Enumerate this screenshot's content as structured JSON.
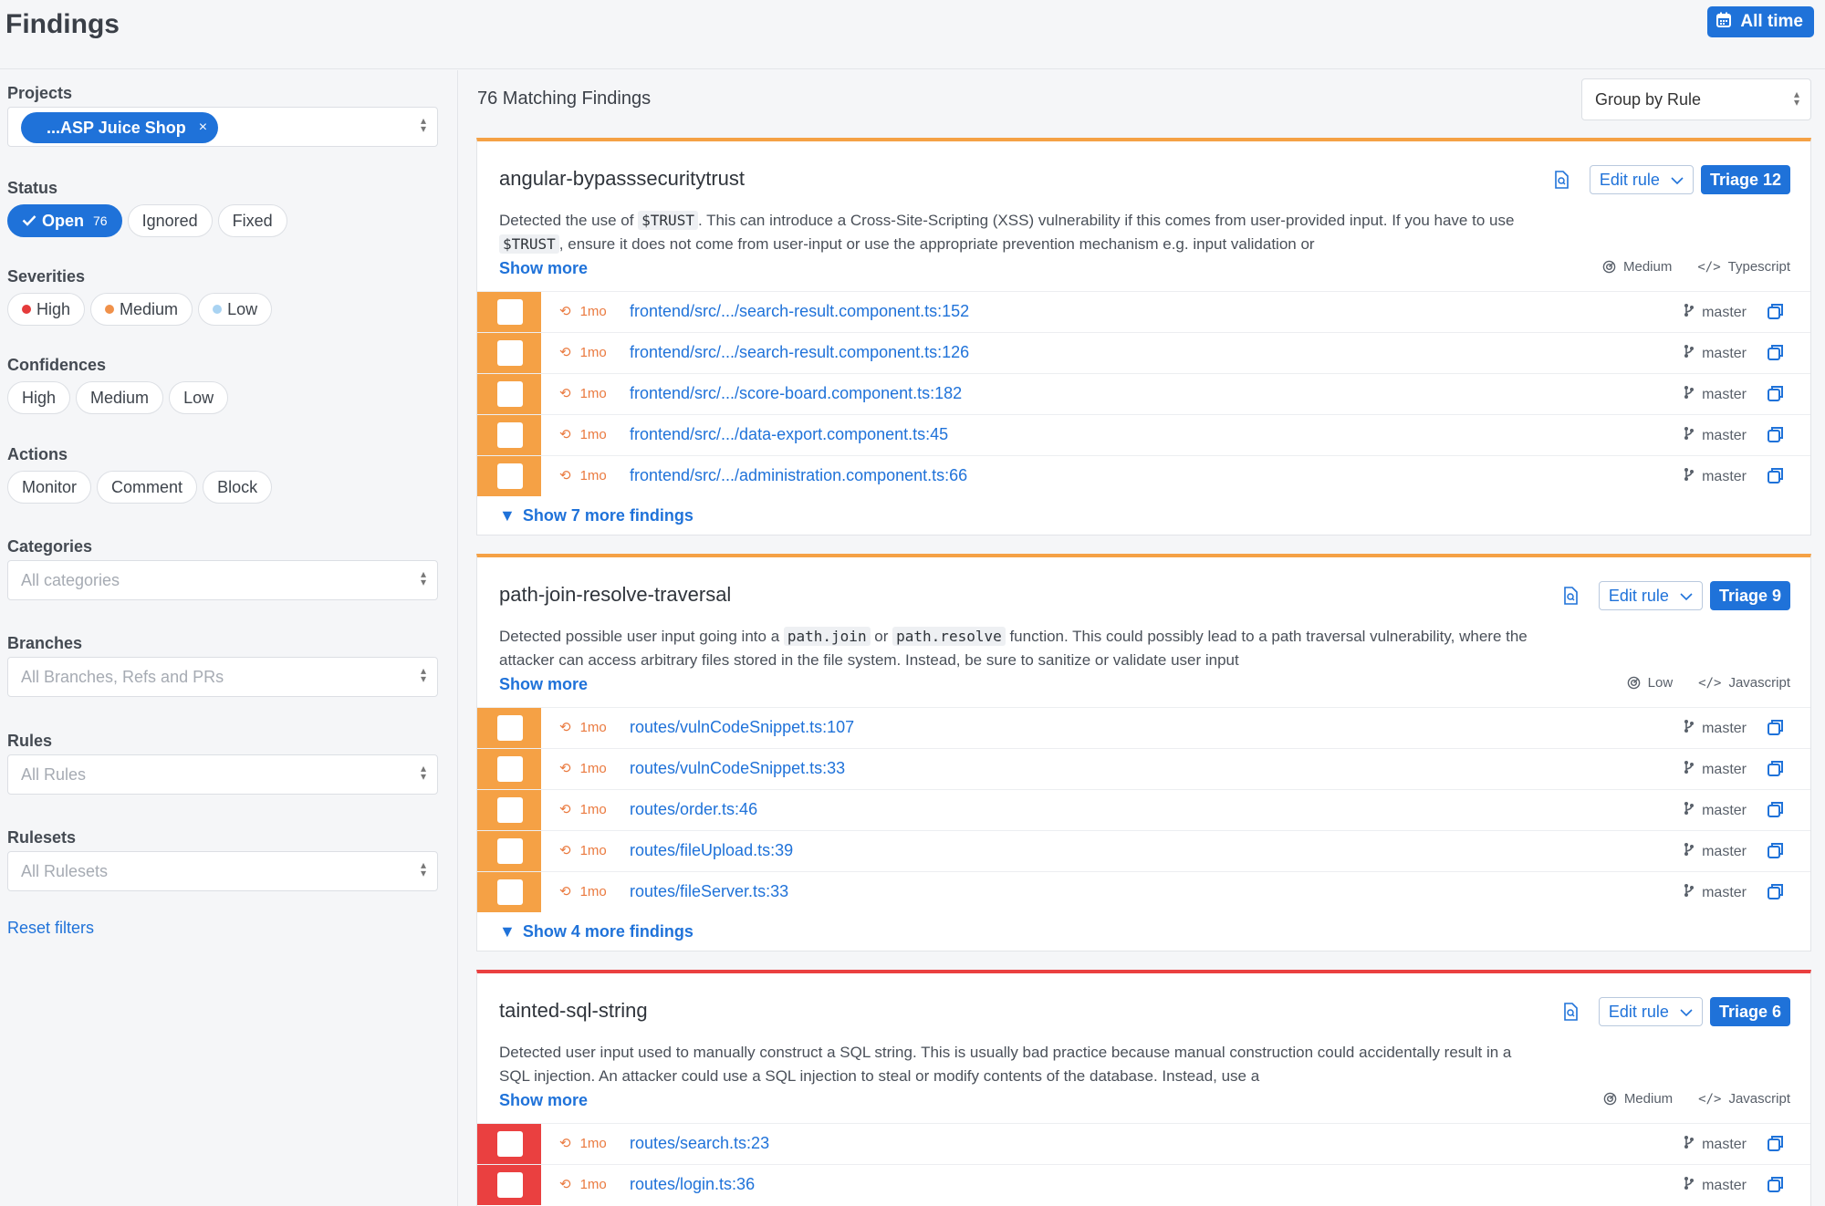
{
  "header": {
    "title": "Findings",
    "time_range": "All time"
  },
  "sidebar": {
    "projects": {
      "label": "Projects",
      "selected": "...ASP Juice Shop"
    },
    "status": {
      "label": "Status",
      "open": "Open",
      "open_count": "76",
      "ignored": "Ignored",
      "fixed": "Fixed"
    },
    "severities": {
      "label": "Severities",
      "high": "High",
      "medium": "Medium",
      "low": "Low",
      "colors": {
        "high": "#e53b3b",
        "medium": "#f0914a",
        "low": "#a9d3f2"
      }
    },
    "confidences": {
      "label": "Confidences",
      "high": "High",
      "medium": "Medium",
      "low": "Low"
    },
    "actions": {
      "label": "Actions",
      "monitor": "Monitor",
      "comment": "Comment",
      "block": "Block"
    },
    "categories": {
      "label": "Categories",
      "placeholder": "All categories"
    },
    "branches": {
      "label": "Branches",
      "placeholder": "All Branches, Refs and PRs"
    },
    "rules": {
      "label": "Rules",
      "placeholder": "All Rules"
    },
    "rulesets": {
      "label": "Rulesets",
      "placeholder": "All Rulesets"
    },
    "reset": "Reset filters"
  },
  "main": {
    "match_count": "76 Matching Findings",
    "group_by": "Group by Rule",
    "cards": [
      {
        "rule": "angular-bypasssecuritytrust",
        "edit": "Edit rule",
        "triage": "Triage 12",
        "desc_a": "Detected the use of ",
        "code1": "$TRUST",
        "desc_b": ". This can introduce a Cross-Site-Scripting (XSS) vulnerability if this comes from user-provided input. If you have to use ",
        "code2": "$TRUST",
        "desc_c": ", ensure it does not come from user-input or use the appropriate prevention mechanism e.g. input validation or",
        "show_more": "Show more",
        "confidence": "Medium",
        "language": "Typescript",
        "findings": [
          {
            "age": "1mo",
            "path": "frontend/src/.../search-result.component.ts:152",
            "branch": "master"
          },
          {
            "age": "1mo",
            "path": "frontend/src/.../search-result.component.ts:126",
            "branch": "master"
          },
          {
            "age": "1mo",
            "path": "frontend/src/.../score-board.component.ts:182",
            "branch": "master"
          },
          {
            "age": "1mo",
            "path": "frontend/src/.../data-export.component.ts:45",
            "branch": "master"
          },
          {
            "age": "1mo",
            "path": "frontend/src/.../administration.component.ts:66",
            "branch": "master"
          }
        ],
        "more": "Show 7 more findings"
      },
      {
        "rule": "path-join-resolve-traversal",
        "edit": "Edit rule",
        "triage": "Triage 9",
        "desc_a": "Detected possible user input going into a ",
        "code1": "path.join",
        "desc_mid": " or ",
        "code2": "path.resolve",
        "desc_b": " function. This could possibly lead to a path traversal vulnerability, where the attacker can access arbitrary files stored in the file system. Instead, be sure to sanitize or validate user input",
        "show_more": "Show more",
        "confidence": "Low",
        "language": "Javascript",
        "findings": [
          {
            "age": "1mo",
            "path": "routes/vulnCodeSnippet.ts:107",
            "branch": "master"
          },
          {
            "age": "1mo",
            "path": "routes/vulnCodeSnippet.ts:33",
            "branch": "master"
          },
          {
            "age": "1mo",
            "path": "routes/order.ts:46",
            "branch": "master"
          },
          {
            "age": "1mo",
            "path": "routes/fileUpload.ts:39",
            "branch": "master"
          },
          {
            "age": "1mo",
            "path": "routes/fileServer.ts:33",
            "branch": "master"
          }
        ],
        "more": "Show 4 more findings"
      },
      {
        "rule": "tainted-sql-string",
        "edit": "Edit rule",
        "triage": "Triage 6",
        "desc": "Detected user input used to manually construct a SQL string. This is usually bad practice because manual construction could accidentally result in a SQL injection. An attacker could use a SQL injection to steal or modify contents of the database. Instead, use a",
        "show_more": "Show more",
        "confidence": "Medium",
        "language": "Javascript",
        "findings": [
          {
            "age": "1mo",
            "path": "routes/search.ts:23",
            "branch": "master"
          },
          {
            "age": "1mo",
            "path": "routes/login.ts:36",
            "branch": "master"
          }
        ]
      }
    ]
  },
  "colors": {
    "accent": "#1f72d9",
    "severity_medium": "#f5a145",
    "severity_high": "#ea4040"
  }
}
